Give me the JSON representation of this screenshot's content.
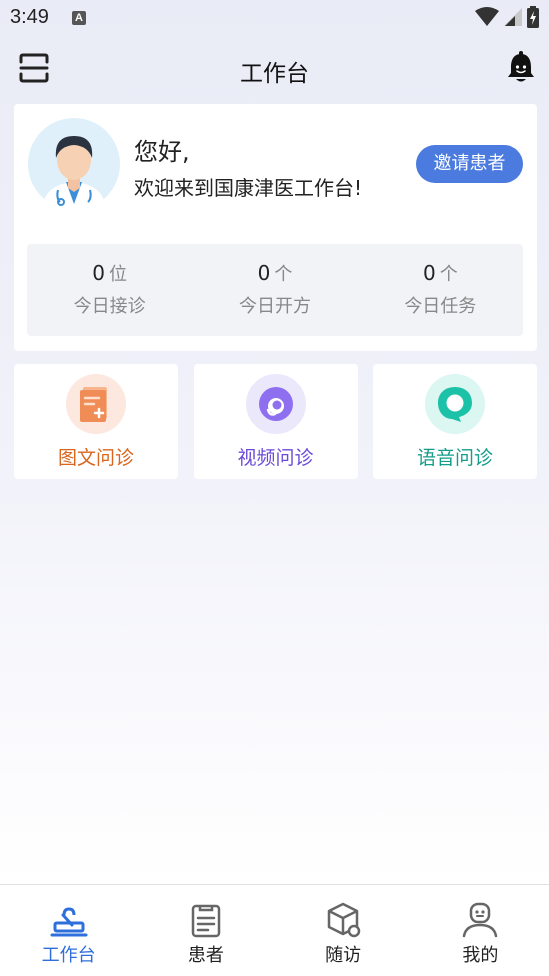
{
  "status_bar": {
    "time": "3:49",
    "notification_badge": "A"
  },
  "header": {
    "title": "工作台",
    "scan_icon": "scan-icon",
    "bell_icon": "bell-icon"
  },
  "welcome": {
    "greeting": "您好,",
    "message": "欢迎来到国康津医工作台!",
    "invite_label": "邀请患者",
    "invite_color": "#4b7bdf"
  },
  "stats": [
    {
      "value": "0",
      "unit": "位",
      "label": "今日接诊"
    },
    {
      "value": "0",
      "unit": "个",
      "label": "今日开方"
    },
    {
      "value": "0",
      "unit": "个",
      "label": "今日任务"
    }
  ],
  "services": [
    {
      "label": "图文问诊",
      "icon": "document-icon",
      "color": "#d8661e",
      "bg": "#fde8df"
    },
    {
      "label": "视频问诊",
      "icon": "video-icon",
      "color": "#6a4bd8",
      "bg": "#ece8fc"
    },
    {
      "label": "语音问诊",
      "icon": "voice-icon",
      "color": "#159d8a",
      "bg": "#dcf6f2"
    }
  ],
  "bottom_nav": [
    {
      "label": "工作台",
      "icon": "workbench-icon",
      "active": true
    },
    {
      "label": "患者",
      "icon": "patients-icon",
      "active": false
    },
    {
      "label": "随访",
      "icon": "followup-icon",
      "active": false
    },
    {
      "label": "我的",
      "icon": "profile-icon",
      "active": false
    }
  ],
  "colors": {
    "accent": "#2e6fdc",
    "page_bg": "#e9ecf6"
  }
}
